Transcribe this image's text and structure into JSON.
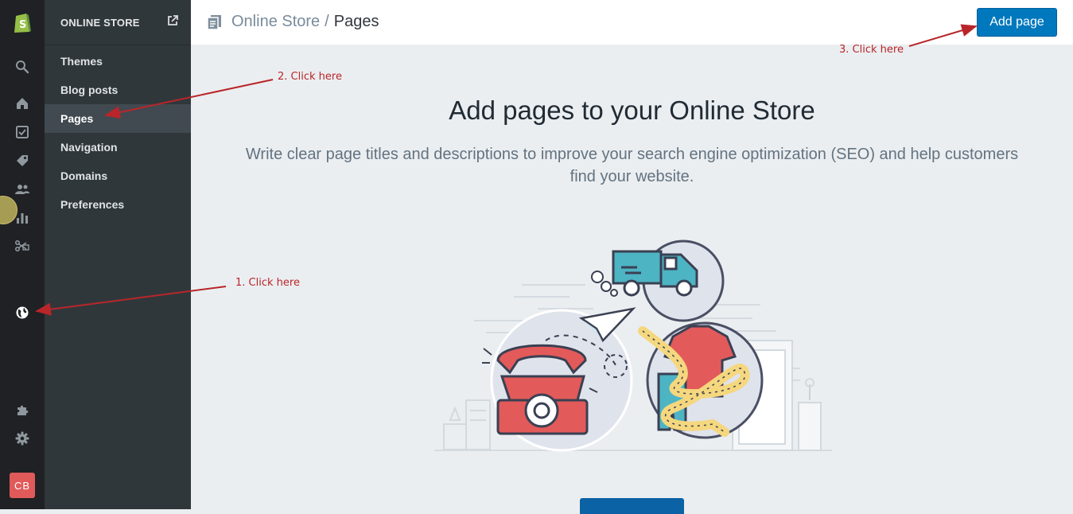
{
  "rail": {
    "items": [
      {
        "name": "shopify-logo-icon"
      },
      {
        "name": "search-icon"
      },
      {
        "name": "home-icon"
      },
      {
        "name": "orders-icon"
      },
      {
        "name": "products-tag-icon"
      },
      {
        "name": "customers-icon"
      },
      {
        "name": "analytics-icon"
      },
      {
        "name": "discounts-icon"
      },
      {
        "name": "online-store-globe-icon"
      },
      {
        "name": "apps-puzzle-icon"
      },
      {
        "name": "settings-gear-icon"
      }
    ],
    "avatar_initials": "CB"
  },
  "subnav": {
    "title": "ONLINE STORE",
    "items": [
      {
        "label": "Themes"
      },
      {
        "label": "Blog posts"
      },
      {
        "label": "Pages"
      },
      {
        "label": "Navigation"
      },
      {
        "label": "Domains"
      },
      {
        "label": "Preferences"
      }
    ],
    "active_index": 2
  },
  "topbar": {
    "breadcrumb_parent": "Online Store",
    "breadcrumb_sep": "/",
    "breadcrumb_current": "Pages",
    "add_button_label": "Add page"
  },
  "main": {
    "headline": "Add pages to your Online Store",
    "description": "Write clear page titles and descriptions to improve your search engine optimization (SEO) and help customers find your website."
  },
  "annotations": {
    "note1": "1. Click here",
    "note2": "2. Click here",
    "note3": "3. Click here"
  },
  "colors": {
    "accent": "#0078bd",
    "annotation": "#b8262a",
    "rail_bg": "#1f2124",
    "subnav_bg": "#30373b"
  }
}
